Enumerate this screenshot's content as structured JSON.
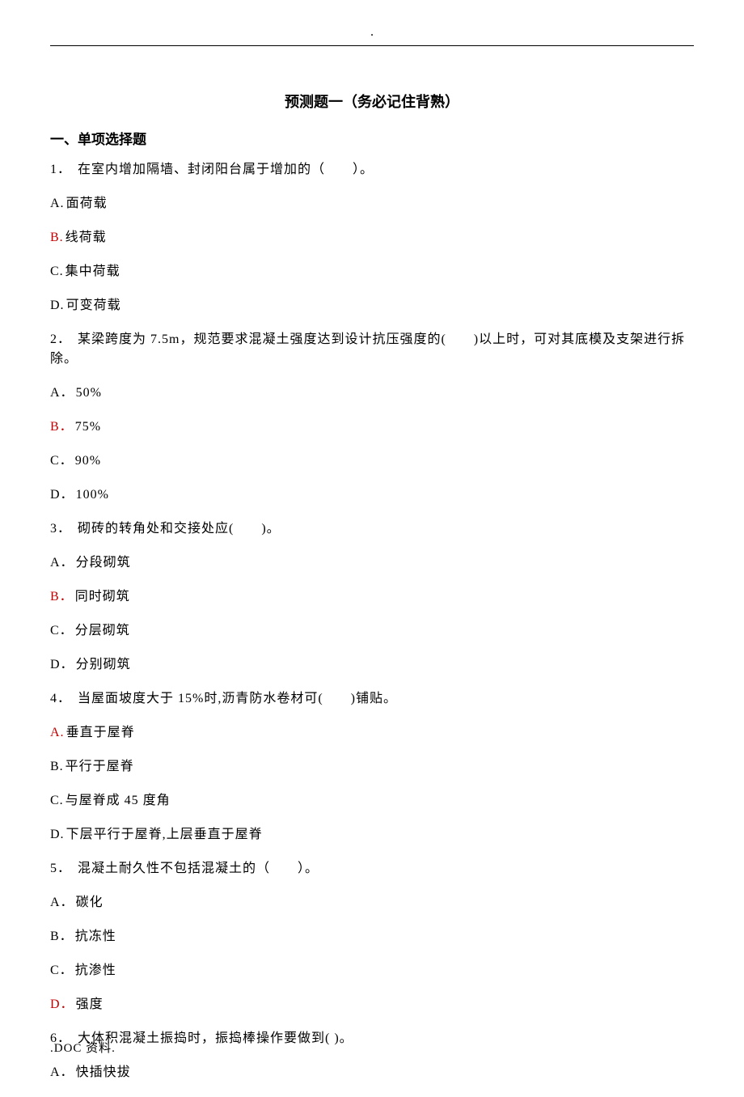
{
  "header": {
    "dot": "."
  },
  "title": "预测题一（务必记住背熟）",
  "sectionHeading": "一、单项选择题",
  "lines": [
    {
      "type": "question",
      "prefix": "1．",
      "text": "在室内增加隔墙、封闭阳台属于增加的（　　）。"
    },
    {
      "type": "option",
      "label": "A.",
      "text": "面荷载"
    },
    {
      "type": "answer",
      "label": "B.",
      "text": "线荷载"
    },
    {
      "type": "option",
      "label": "C.",
      "text": "集中荷载"
    },
    {
      "type": "option",
      "label": "D.",
      "text": "可变荷载"
    },
    {
      "type": "question",
      "prefix": "2．",
      "text": "某梁跨度为 7.5m，规范要求混凝土强度达到设计抗压强度的(　　)以上时，可对其底模及支架进行拆除。"
    },
    {
      "type": "option",
      "label": "A．",
      "text": "50%"
    },
    {
      "type": "answer",
      "label": "B．",
      "text": "75%"
    },
    {
      "type": "option",
      "label": "C．",
      "text": "90%"
    },
    {
      "type": "option",
      "label": "D．",
      "text": "100%"
    },
    {
      "type": "question",
      "prefix": "3．",
      "text": "砌砖的转角处和交接处应(　　)。"
    },
    {
      "type": "option",
      "label": "A．",
      "text": "分段砌筑"
    },
    {
      "type": "answer",
      "label": "B．",
      "text": "同时砌筑"
    },
    {
      "type": "option",
      "label": "C．",
      "text": "分层砌筑"
    },
    {
      "type": "option",
      "label": "D．",
      "text": "分别砌筑"
    },
    {
      "type": "question",
      "prefix": "4．",
      "text": "当屋面坡度大于 15%时,沥青防水卷材可(　　)铺贴。"
    },
    {
      "type": "answer",
      "label": "A.",
      "text": "垂直于屋脊"
    },
    {
      "type": "option",
      "label": "B.",
      "text": "平行于屋脊"
    },
    {
      "type": "option",
      "label": "C.",
      "text": "与屋脊成 45 度角"
    },
    {
      "type": "option",
      "label": "D.",
      "text": "下层平行于屋脊,上层垂直于屋脊"
    },
    {
      "type": "question",
      "prefix": "5．",
      "text": "混凝土耐久性不包括混凝土的（　　）。"
    },
    {
      "type": "option",
      "label": "A．",
      "text": "碳化"
    },
    {
      "type": "option",
      "label": "B．",
      "text": "抗冻性"
    },
    {
      "type": "option",
      "label": "C．",
      "text": "抗渗性"
    },
    {
      "type": "answer",
      "label": "D．",
      "text": "强度"
    },
    {
      "type": "question",
      "prefix": "6．",
      "text": "大体积混凝土振捣时，振捣棒操作要做到( )。"
    },
    {
      "type": "option",
      "label": "A．",
      "text": "快插快拔"
    }
  ],
  "footer": ".DOC 资料."
}
